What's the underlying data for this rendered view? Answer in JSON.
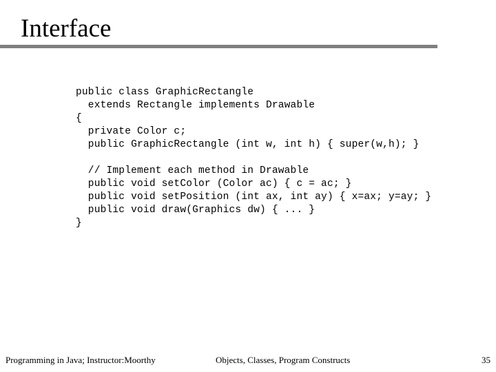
{
  "slide": {
    "title": "Interface",
    "rule_color": "#808080",
    "background_color": "#ffffff",
    "text_color": "#000000"
  },
  "code": {
    "lines": [
      "public class GraphicRectangle",
      "  extends Rectangle implements Drawable",
      "{",
      "  private Color c;",
      "  public GraphicRectangle (int w, int h) { super(w,h); }",
      "",
      "  // Implement each method in Drawable",
      "  public void setColor (Color ac) { c = ac; }",
      "  public void setPosition (int ax, int ay) { x=ax; y=ay; }",
      "  public void draw(Graphics dw) { ... }",
      "}"
    ]
  },
  "footer": {
    "left": "Programming in Java; Instructor:Moorthy",
    "center": "Objects, Classes, Program Constructs",
    "page_number": "35"
  }
}
